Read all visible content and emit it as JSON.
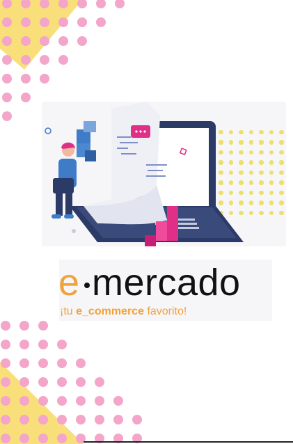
{
  "brand": {
    "logo_e": "e",
    "logo_rest": "mercado",
    "tagline_before": "¡tu ",
    "tagline_bold": "e_commerce",
    "tagline_after": " favorito!"
  },
  "colors": {
    "pink": "#f3a6c9",
    "yellow": "#f7da6e",
    "orange": "#f0a23b",
    "navy": "#2b3a67",
    "magenta": "#e02f86",
    "blue": "#3f7cc7"
  },
  "illustration": {
    "icon": "person-with-laptop-and-receipt-illustration"
  }
}
